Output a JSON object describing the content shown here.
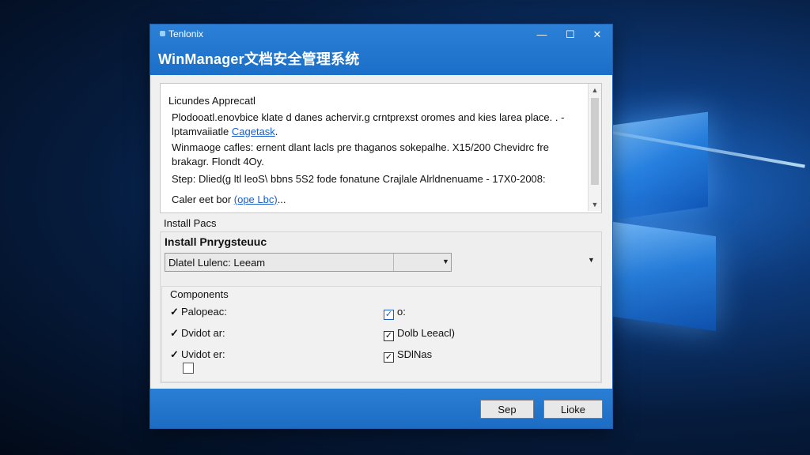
{
  "window": {
    "app_name": "Tenlonix",
    "heading": "WinManager文档安全管理系统",
    "controls": {
      "minimize": "—",
      "maximize": "☐",
      "close": "✕"
    }
  },
  "license": {
    "title": "Licundes Apprecatl",
    "lines": [
      {
        "text": "Plodooatl.enovbice klate d danes achervir.g crntprexst oromes and kies larea place. . -",
        "link": ""
      },
      {
        "text": "lptamvaiiatle ",
        "link": "Cagetask",
        "suffix": "."
      },
      {
        "text": "Winmaoge cafles: ernent dlant lacls pre thaganos sokepalhe. X15/200 Chevidrc fre",
        "link": ""
      },
      {
        "text": "brakagr. Flondt 4Oy.",
        "link": ""
      },
      {
        "text": "Step: Dlied(g ltl leoS\\ bbns 5S2 fode fonatune Crajlale Alrldnenuame - 17X0-2008:",
        "link": ""
      },
      {
        "text": "Caler eet bor ",
        "link": "(ope Lbc)",
        "suffix": "..."
      }
    ]
  },
  "install": {
    "section_label": "Install Pacs",
    "sub_label": "Install Pnrygsteuuc",
    "select_value": "Dlatel Lulenc: Leeam",
    "components_title": "Components",
    "left_items": [
      {
        "label": "Palopeac:",
        "checked": true
      },
      {
        "label": "Dvidot ar:",
        "checked": true
      },
      {
        "label": "Uvidot er:",
        "checked": true
      }
    ],
    "right_items": [
      {
        "label": "o:",
        "checked": true
      },
      {
        "label": "Dolb Leeacl)",
        "checked": true
      },
      {
        "label": "SDlNas",
        "checked": true
      }
    ],
    "extra_checkbox_checked": false
  },
  "footer": {
    "button_1": "Sep",
    "button_2": "Lioke"
  },
  "colors": {
    "title_blue": "#1b6fc8",
    "link_blue": "#1a5ec9"
  }
}
